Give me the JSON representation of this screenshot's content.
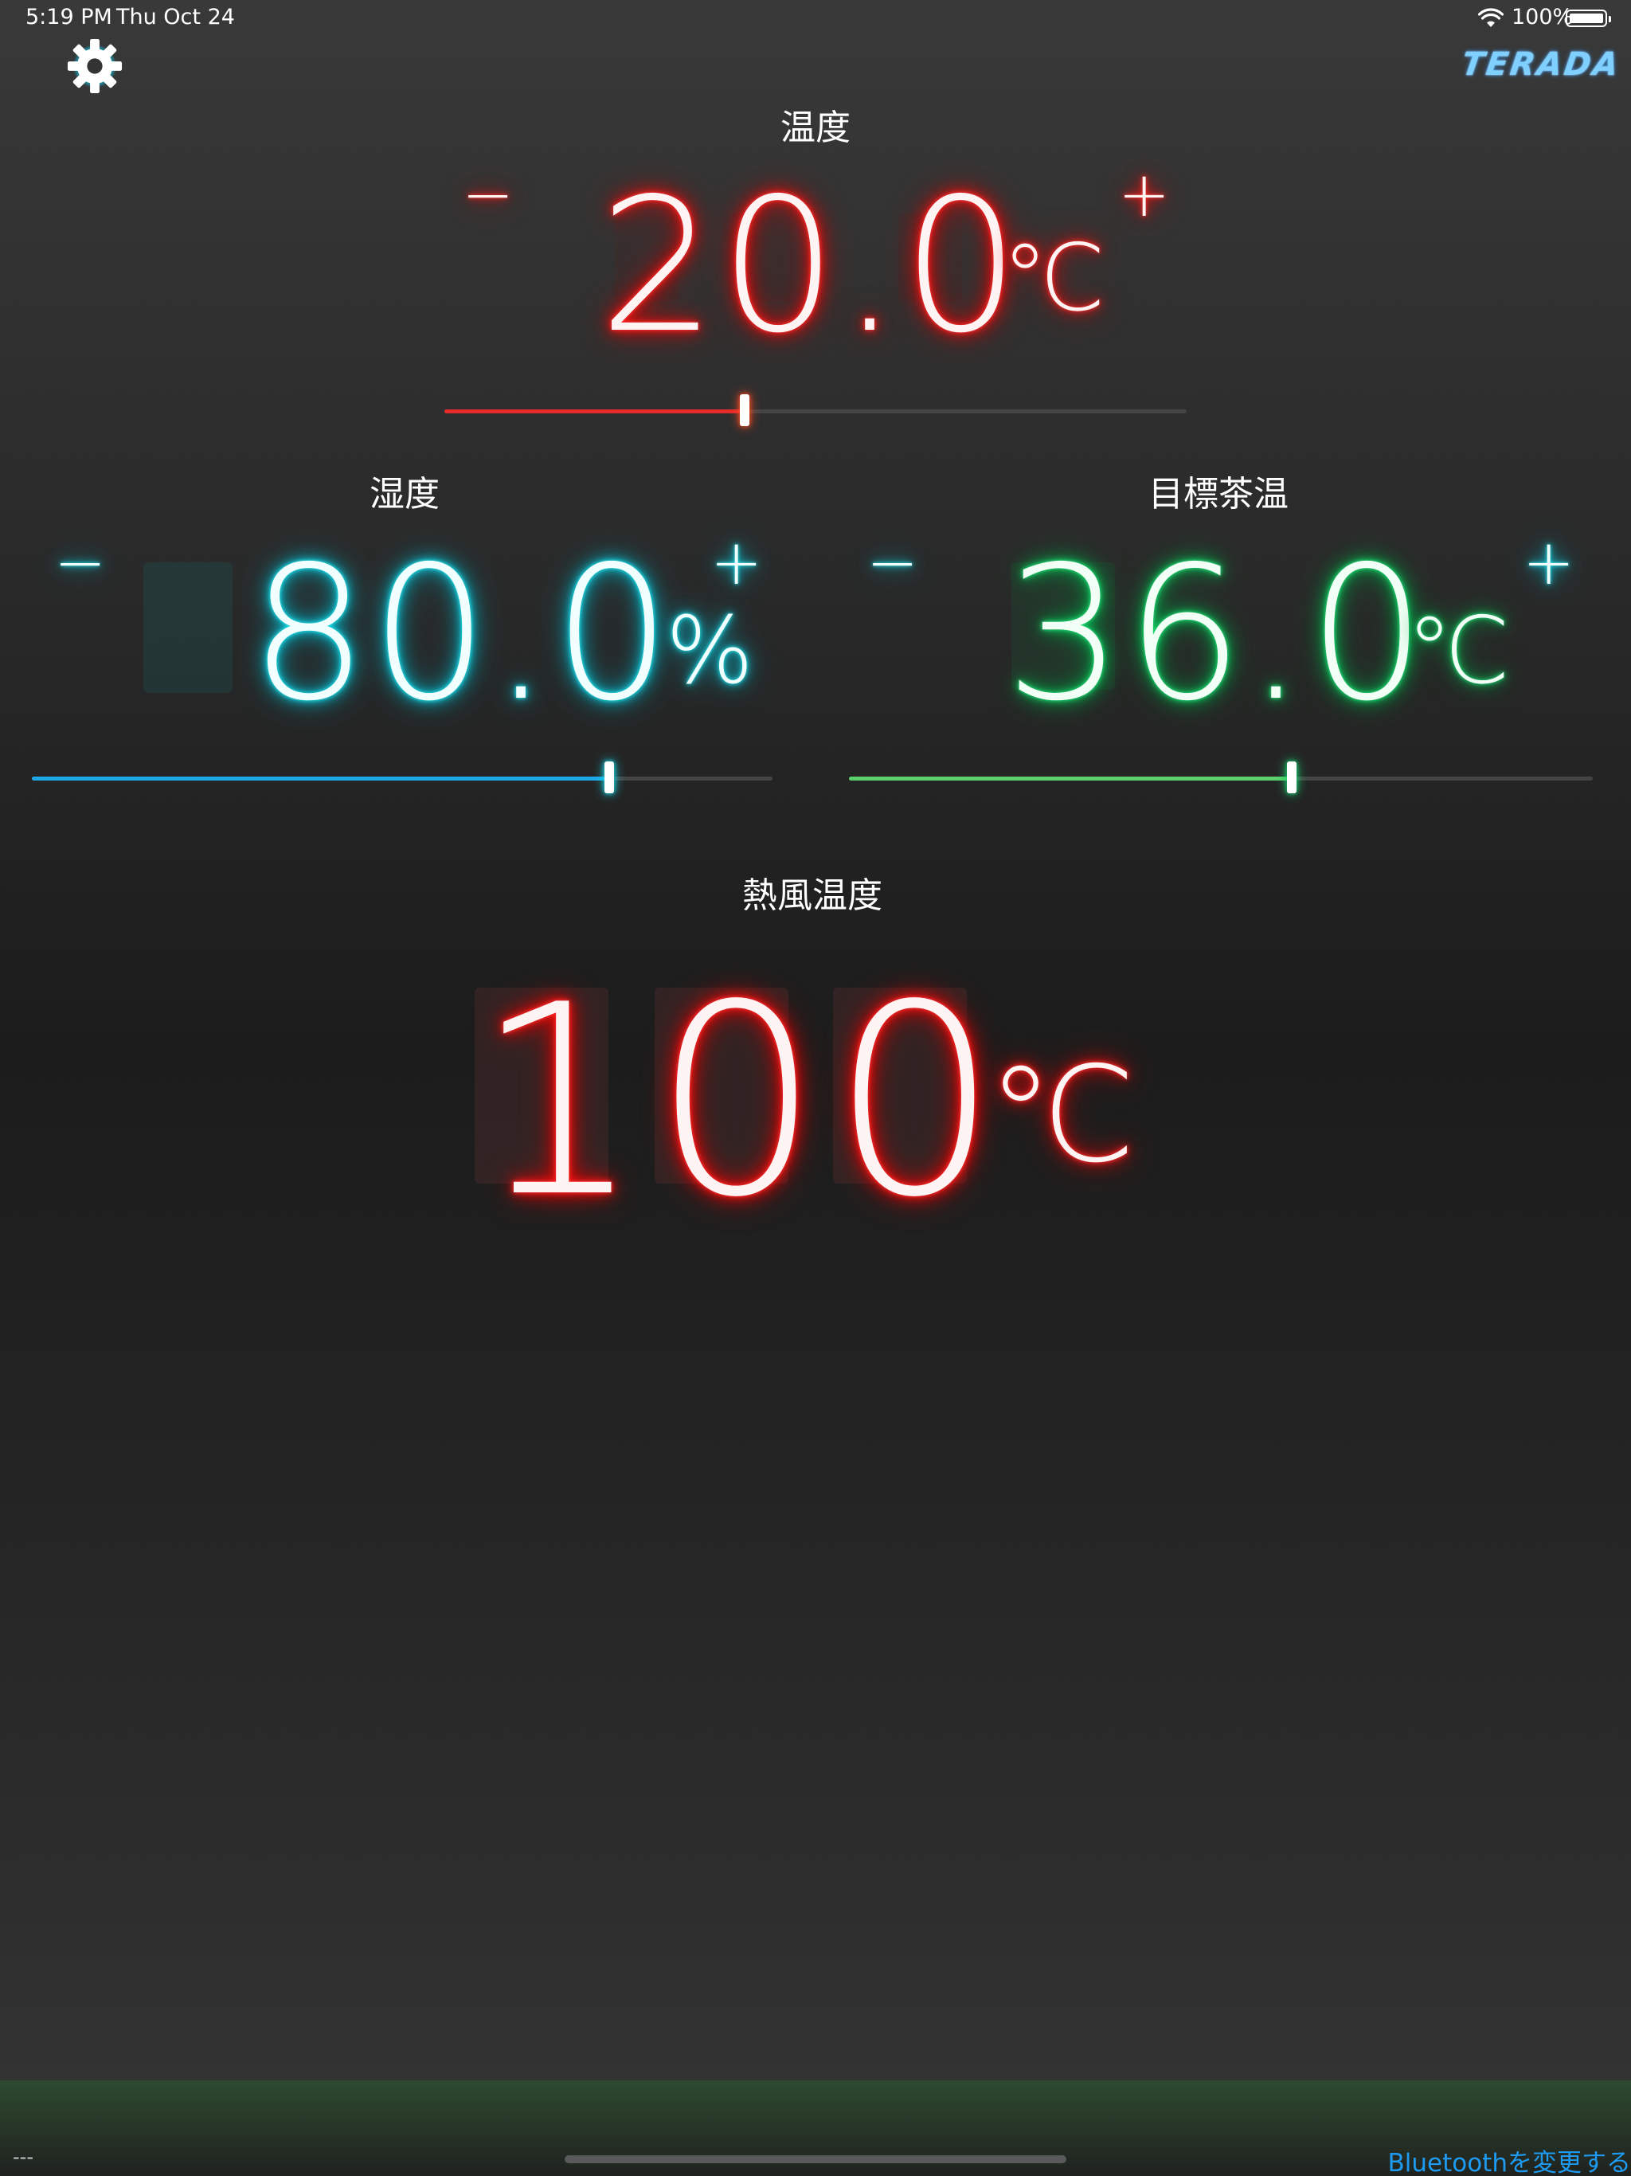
{
  "status_bar": {
    "time": "5:19 PM",
    "date": "Thu Oct 24",
    "battery": "100%",
    "battery_level": 1.0,
    "wifi_icon": "wifi-icon",
    "battery_icon": "battery-icon"
  },
  "header": {
    "settings_icon": "gear-icon",
    "logo": "TERADA"
  },
  "temperature": {
    "label": "温度",
    "value": "20.0",
    "unit": "℃",
    "minus": "−",
    "plus": "+",
    "slider_level": 0.405,
    "color": "#e52b2b"
  },
  "humidity": {
    "label": "湿度",
    "value": "80.0",
    "unit": "%",
    "minus": "−",
    "plus": "+",
    "slider_level": 0.78,
    "color": "#1ea8e8"
  },
  "target_tea_temp": {
    "label": "目標茶温",
    "value": "36.0",
    "unit": "℃",
    "minus": "−",
    "plus": "+",
    "slider_level": 0.595,
    "color": "#5cd06a"
  },
  "hot_air_temp": {
    "label": "熱風温度",
    "value": "100",
    "unit": "℃"
  },
  "footer": {
    "status_text": "---",
    "bluetooth_link": "Bluetoothを変更する"
  }
}
